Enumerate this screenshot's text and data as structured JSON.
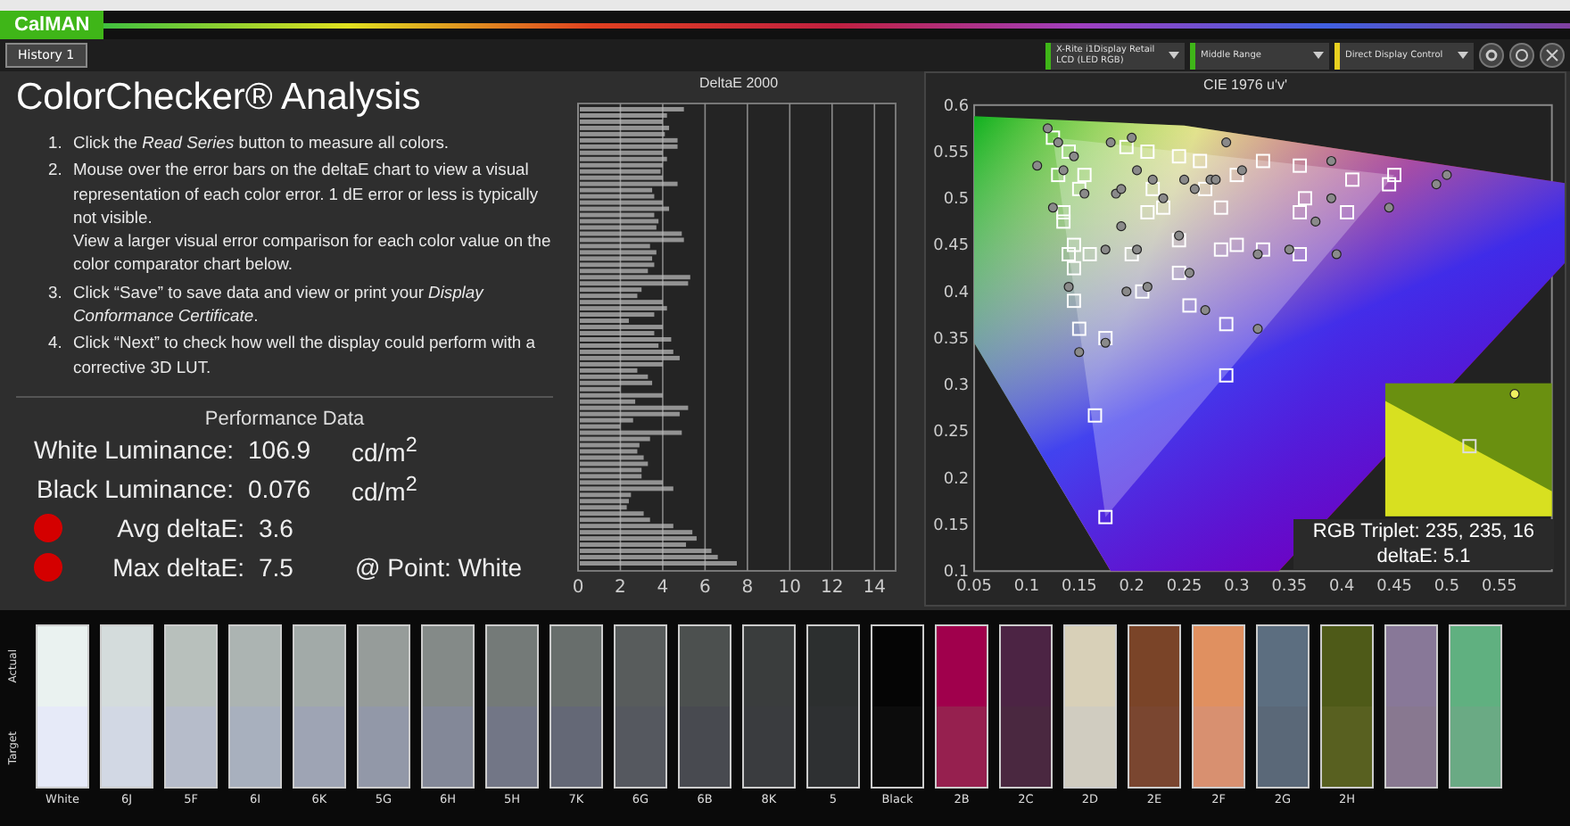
{
  "app": {
    "logo": "CalMAN",
    "tab": {
      "label": "History 1",
      "selected": true
    },
    "dropdowns": [
      {
        "label": "X-Rite i1Display Retail",
        "sublabel": "LCD (LED RGB)",
        "color": "#3fb618"
      },
      {
        "label": "Middle Range",
        "color": "#3fb618"
      },
      {
        "label": "Direct Display Control",
        "color": "#e8d020"
      }
    ]
  },
  "analysis": {
    "title": "ColorChecker® Analysis",
    "steps": [
      {
        "number": "1.",
        "text": "Click the *Read Series* button to measure all colors."
      },
      {
        "number": "2.",
        "text": "Mouse over the error bars on the deltaE chart to view a visual representation of each color error. 1 dE error or less is typically not visible.",
        "note": "View a larger visual error comparison for each color value on the color comparator chart below."
      },
      {
        "number": "3.",
        "text": "Click “Save” to save data and view or print your *Display Conformance Certificate*."
      },
      {
        "number": "4.",
        "text": "Click “Next” to check how well the display could perform with a corrective 3D LUT."
      }
    ],
    "performance": {
      "title": "Performance Data",
      "rows": [
        {
          "kind": "plain",
          "label": "White Luminance:",
          "value": "106.9",
          "unit": "cd/m$^{2}$"
        },
        {
          "kind": "plain",
          "label": "Black Luminance:",
          "value": "0.076",
          "unit": "cd/m$^{2}$"
        },
        {
          "kind": "status",
          "label": "Avg deltaE:",
          "value": "3.6",
          "color": "#d40000"
        },
        {
          "kind": "status",
          "label": "Max deltaE:",
          "value": "7.5",
          "extra": "@ Point: White",
          "color": "#d40000"
        }
      ]
    }
  },
  "deltae": {
    "chart_data": {
      "type": "bar",
      "title": "DeltaE 2000",
      "orientation": "horizontal",
      "grid": true,
      "xlim": [
        0,
        15
      ],
      "xticks": [
        0,
        2,
        4,
        6,
        8,
        10,
        12,
        14
      ],
      "series": [
        {
          "color": "#b8b8b8",
          "values": [
            5.0,
            4.2,
            4.0,
            4.3,
            4.1,
            4.7,
            4.7,
            4.0,
            4.2,
            4.0,
            3.9,
            4.0,
            4.7,
            3.5,
            3.6,
            4.0,
            4.3,
            3.6,
            3.8,
            3.7,
            4.9,
            5.0,
            3.4,
            3.7,
            3.5,
            3.6,
            3.3,
            5.3,
            5.2,
            3.0,
            2.8,
            4.0,
            4.2,
            3.6,
            2.4,
            4.0,
            3.6,
            4.4,
            3.8,
            4.5,
            4.8,
            4.0,
            2.8,
            3.3,
            3.5,
            2.0,
            4.0,
            2.7,
            5.2,
            4.8,
            2.6,
            2.0,
            4.9,
            3.4,
            2.9,
            2.8,
            3.1,
            3.3,
            3.0,
            3.0,
            4.0,
            4.5,
            2.5,
            2.4,
            2.3,
            3.1,
            3.4,
            4.5,
            5.4,
            5.6,
            5.1,
            6.3,
            6.6,
            7.5
          ]
        }
      ]
    }
  },
  "cie": {
    "chart_data": {
      "type": "scatter",
      "title": "CIE 1976 u'v'",
      "xlim": [
        0.05,
        0.6
      ],
      "ylim": [
        0.1,
        0.6
      ],
      "xticks": [
        {
          "value": 0.05,
          "label": "0.05"
        },
        {
          "value": 0.1,
          "label": "0.1"
        },
        {
          "value": 0.15,
          "label": "0.15"
        },
        {
          "value": 0.2,
          "label": "0.2"
        },
        {
          "value": 0.25,
          "label": "0.25"
        },
        {
          "value": 0.3,
          "label": "0.3"
        },
        {
          "value": 0.35,
          "label": "0.35"
        },
        {
          "value": 0.4,
          "label": "0.4"
        },
        {
          "value": 0.45,
          "label": "0.45"
        },
        {
          "value": 0.5,
          "label": "0.5"
        },
        {
          "value": 0.55,
          "label": "0.55"
        }
      ],
      "yticks": [
        {
          "value": 0.1,
          "label": "0.1"
        },
        {
          "value": 0.15,
          "label": "0.15"
        },
        {
          "value": 0.2,
          "label": "0.2"
        },
        {
          "value": 0.25,
          "label": "0.25"
        },
        {
          "value": 0.3,
          "label": "0.3"
        },
        {
          "value": 0.35,
          "label": "0.35"
        },
        {
          "value": 0.4,
          "label": "0.4"
        },
        {
          "value": 0.45,
          "label": "0.45"
        },
        {
          "value": 0.5,
          "label": "0.5"
        },
        {
          "value": 0.55,
          "label": "0.55"
        },
        {
          "value": 0.6,
          "label": "0.6"
        }
      ],
      "series": [
        {
          "color": "#ffffff",
          "x": [
            0.125,
            0.14,
            0.13,
            0.155,
            0.15,
            0.135,
            0.135,
            0.145,
            0.16,
            0.14,
            0.145,
            0.145,
            0.15,
            0.175,
            0.165,
            0.175,
            0.2,
            0.21,
            0.215,
            0.23,
            0.245,
            0.245,
            0.255,
            0.29,
            0.29,
            0.285,
            0.3,
            0.325,
            0.36,
            0.36,
            0.365,
            0.405,
            0.41,
            0.445,
            0.45,
            0.36,
            0.325,
            0.3,
            0.285,
            0.265,
            0.27,
            0.245,
            0.215,
            0.195,
            0.22
          ],
          "values": [
            0.565,
            0.55,
            0.525,
            0.525,
            0.51,
            0.485,
            0.475,
            0.45,
            0.44,
            0.44,
            0.425,
            0.39,
            0.36,
            0.35,
            0.267,
            0.158,
            0.44,
            0.4,
            0.485,
            0.49,
            0.42,
            0.455,
            0.385,
            0.365,
            0.31,
            0.445,
            0.45,
            0.445,
            0.44,
            0.485,
            0.5,
            0.485,
            0.52,
            0.515,
            0.525,
            0.535,
            0.54,
            0.525,
            0.49,
            0.54,
            0.51,
            0.545,
            0.55,
            0.555,
            0.51
          ]
        },
        {
          "color": "#8a8a8a",
          "x": [
            0.11,
            0.12,
            0.13,
            0.125,
            0.135,
            0.145,
            0.155,
            0.185,
            0.19,
            0.18,
            0.2,
            0.22,
            0.205,
            0.23,
            0.25,
            0.26,
            0.275,
            0.28,
            0.29,
            0.305,
            0.19,
            0.175,
            0.205,
            0.195,
            0.215,
            0.14,
            0.15,
            0.175,
            0.245,
            0.255,
            0.27,
            0.32,
            0.32,
            0.35,
            0.375,
            0.39,
            0.395,
            0.445,
            0.39,
            0.49,
            0.5
          ],
          "values": [
            0.535,
            0.575,
            0.56,
            0.49,
            0.53,
            0.545,
            0.505,
            0.505,
            0.51,
            0.56,
            0.565,
            0.52,
            0.53,
            0.5,
            0.52,
            0.51,
            0.52,
            0.52,
            0.56,
            0.53,
            0.47,
            0.445,
            0.445,
            0.4,
            0.405,
            0.405,
            0.335,
            0.345,
            0.46,
            0.42,
            0.38,
            0.36,
            0.44,
            0.445,
            0.475,
            0.5,
            0.44,
            0.49,
            0.54,
            0.515,
            0.525
          ]
        }
      ]
    },
    "triplet": "RGB Triplet: 235, 235, 16",
    "deltae": "deltaE: 5.1"
  },
  "comparator": {
    "actual_label": "Actual",
    "target_label": "Target",
    "swatches": [
      {
        "label": "White",
        "color": "#eaf2f0",
        "target": {
          "color": "#e6eaf8"
        }
      },
      {
        "label": "6J",
        "color": "#d4dcdc",
        "target": {
          "color": "#d2d8e4"
        }
      },
      {
        "label": "5F",
        "color": "#b8c0bc",
        "target": {
          "color": "#b6bcca"
        }
      },
      {
        "label": "6I",
        "color": "#acb4b2",
        "target": {
          "color": "#a8b0be"
        }
      },
      {
        "label": "6K",
        "color": "#a2aaa8",
        "target": {
          "color": "#9ea4b4"
        }
      },
      {
        "label": "5G",
        "color": "#969c9a",
        "target": {
          "color": "#9298a8"
        }
      },
      {
        "label": "6H",
        "color": "#848a88",
        "target": {
          "color": "#838898"
        }
      },
      {
        "label": "5H",
        "color": "#747a78",
        "target": {
          "color": "#727686"
        }
      },
      {
        "label": "7K",
        "color": "#686e6c",
        "target": {
          "color": "#646876"
        }
      },
      {
        "label": "6G",
        "color": "#585c5c",
        "target": {
          "color": "#55585f"
        }
      },
      {
        "label": "6B",
        "color": "#4c504f",
        "target": {
          "color": "#484a50"
        }
      },
      {
        "label": "8K",
        "color": "#3a3d3d",
        "target": {
          "color": "#3a3c3f"
        }
      },
      {
        "label": "5",
        "color": "#2c2f2f",
        "target": {
          "color": "#2e3032"
        }
      },
      {
        "label": "Black",
        "color": "#050505",
        "target": {
          "color": "#0c0c0c"
        }
      },
      {
        "label": "2B",
        "color": "#a0004c",
        "target": {
          "color": "#96204f"
        }
      },
      {
        "label": "2C",
        "color": "#4c2444",
        "target": {
          "color": "#4a2840"
        }
      },
      {
        "label": "2D",
        "color": "#d8d0b8",
        "target": {
          "color": "#d0ccc0"
        }
      },
      {
        "label": "2E",
        "color": "#7a4428",
        "target": {
          "color": "#7a4630"
        }
      },
      {
        "label": "2F",
        "color": "#e09060",
        "target": {
          "color": "#d89070"
        }
      },
      {
        "label": "2G",
        "color": "#5c6e80",
        "target": {
          "color": "#5a6878"
        }
      },
      {
        "label": "2H",
        "color": "#4e5a18",
        "target": {
          "color": "#586020"
        }
      },
      {
        "color": "#887898",
        "target": {
          "color": "#887890"
        }
      },
      {
        "color": "#60b080",
        "target": {
          "color": "#6aaa84"
        }
      }
    ]
  }
}
